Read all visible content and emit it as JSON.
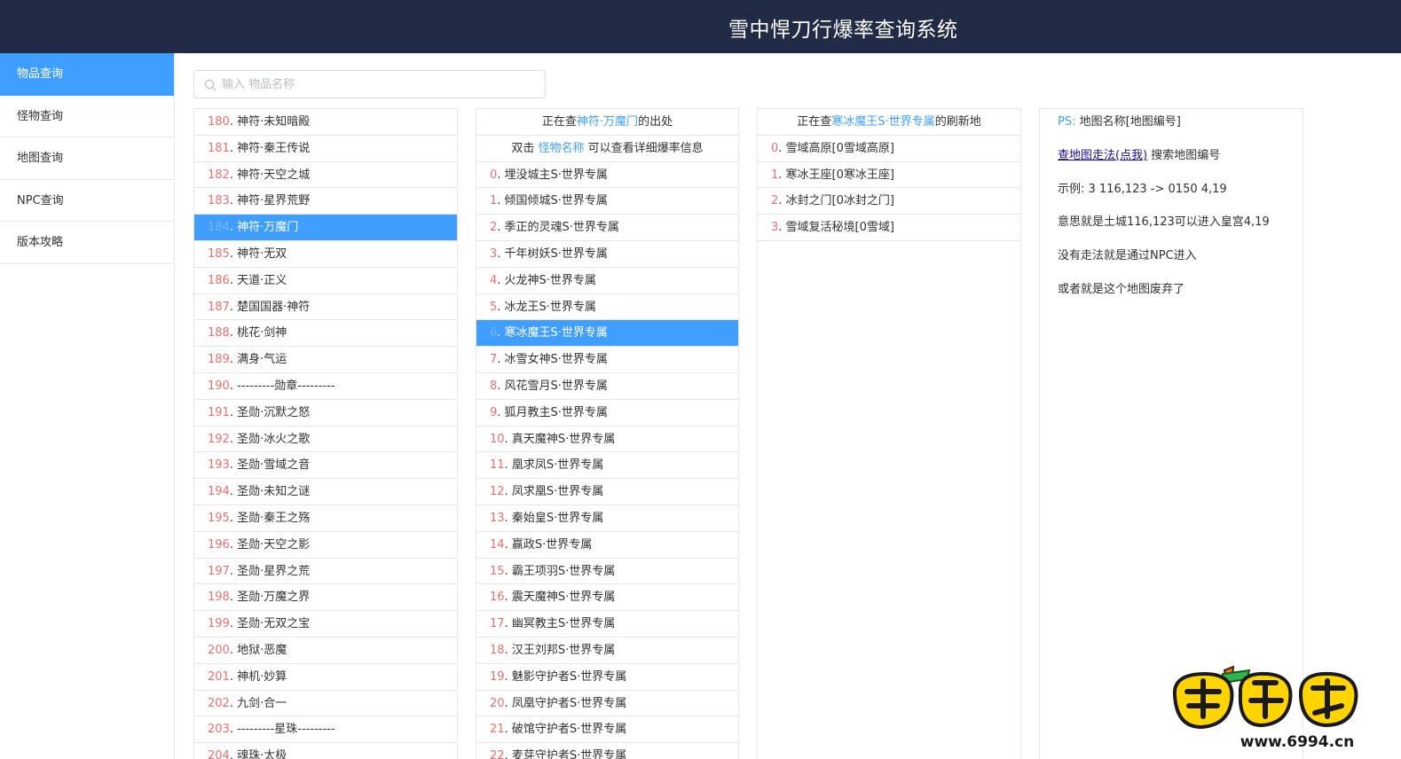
{
  "header": {
    "title": "雪中悍刀行爆率查询系统"
  },
  "sidebar": {
    "items": [
      {
        "label": "物品查询",
        "active": true
      },
      {
        "label": "怪物查询",
        "active": false
      },
      {
        "label": "地图查询",
        "active": false
      },
      {
        "label": "NPC查询",
        "active": false
      },
      {
        "label": "版本攻略",
        "active": false
      }
    ]
  },
  "search": {
    "placeholder": "输入 物品名称",
    "value": ""
  },
  "items": {
    "selected_index": 4,
    "rows": [
      {
        "idx": "180",
        "name": "神符·未知暗殿"
      },
      {
        "idx": "181",
        "name": "神符·秦王传说"
      },
      {
        "idx": "182",
        "name": "神符·天空之城"
      },
      {
        "idx": "183",
        "name": "神符·星界荒野"
      },
      {
        "idx": "184",
        "name": "神符·万魔门"
      },
      {
        "idx": "185",
        "name": "神符·无双"
      },
      {
        "idx": "186",
        "name": "天道·正义"
      },
      {
        "idx": "187",
        "name": "楚国国器·神符"
      },
      {
        "idx": "188",
        "name": "桃花·剑神"
      },
      {
        "idx": "189",
        "name": "满身·气运"
      },
      {
        "idx": "190",
        "name": "---------勋章---------"
      },
      {
        "idx": "191",
        "name": "圣勋·沉默之怒"
      },
      {
        "idx": "192",
        "name": "圣勋·冰火之歌"
      },
      {
        "idx": "193",
        "name": "圣勋·雪域之音"
      },
      {
        "idx": "194",
        "name": "圣勋·未知之谜"
      },
      {
        "idx": "195",
        "name": "圣勋·秦王之殇"
      },
      {
        "idx": "196",
        "name": "圣勋·天空之影"
      },
      {
        "idx": "197",
        "name": "圣勋·星界之荒"
      },
      {
        "idx": "198",
        "name": "圣勋·万魔之界"
      },
      {
        "idx": "199",
        "name": "圣勋·无双之宝"
      },
      {
        "idx": "200",
        "name": "地狱·恶魔"
      },
      {
        "idx": "201",
        "name": "神机·妙算"
      },
      {
        "idx": "202",
        "name": "九剑·合一"
      },
      {
        "idx": "203",
        "name": "---------星珠---------"
      },
      {
        "idx": "204",
        "name": "魂珠·太极"
      }
    ]
  },
  "monsters": {
    "header1": {
      "prefix": "正在查",
      "item": "神符·万魔门",
      "suffix": "的出处"
    },
    "header2": {
      "prefix": "双击 ",
      "link": "怪物名称",
      "suffix": " 可以查看详细爆率信息"
    },
    "selected_index": 6,
    "rows": [
      {
        "idx": "0",
        "name": "埋没城主S·世界专属"
      },
      {
        "idx": "1",
        "name": "倾国倾城S·世界专属"
      },
      {
        "idx": "2",
        "name": "季正的灵魂S·世界专属"
      },
      {
        "idx": "3",
        "name": "千年树妖S·世界专属"
      },
      {
        "idx": "4",
        "name": "火龙神S·世界专属"
      },
      {
        "idx": "5",
        "name": "冰龙王S·世界专属"
      },
      {
        "idx": "6",
        "name": "寒冰魔王S·世界专属"
      },
      {
        "idx": "7",
        "name": "冰雪女神S·世界专属"
      },
      {
        "idx": "8",
        "name": "风花雪月S·世界专属"
      },
      {
        "idx": "9",
        "name": "狐月教主S·世界专属"
      },
      {
        "idx": "10",
        "name": "真天魔神S·世界专属"
      },
      {
        "idx": "11",
        "name": "凰求凤S·世界专属"
      },
      {
        "idx": "12",
        "name": "凤求凰S·世界专属"
      },
      {
        "idx": "13",
        "name": "秦始皇S·世界专属"
      },
      {
        "idx": "14",
        "name": "赢政S·世界专属"
      },
      {
        "idx": "15",
        "name": "霸王项羽S·世界专属"
      },
      {
        "idx": "16",
        "name": "震天魔神S·世界专属"
      },
      {
        "idx": "17",
        "name": "幽冥教主S·世界专属"
      },
      {
        "idx": "18",
        "name": "汉王刘邦S·世界专属"
      },
      {
        "idx": "19",
        "name": "魅影守护者S·世界专属"
      },
      {
        "idx": "20",
        "name": "凤凰守护者S·世界专属"
      },
      {
        "idx": "21",
        "name": "破馆守护者S·世界专属"
      },
      {
        "idx": "22",
        "name": "麦芽守护者S·世界专属"
      }
    ]
  },
  "maps": {
    "header": {
      "prefix": "正在查",
      "monster": "寒冰魔王S·世界专属",
      "suffix": "的刷新地"
    },
    "rows": [
      {
        "idx": "0",
        "name": "雪域高原[0雪域高原]"
      },
      {
        "idx": "1",
        "name": "寒冰王座[0寒冰王座]"
      },
      {
        "idx": "2",
        "name": "冰封之门[0冰封之门]"
      },
      {
        "idx": "3",
        "name": "雪域复活秘境[0雪域]"
      }
    ]
  },
  "notes": {
    "ps_label": "PS:",
    "ps_text": "  地图名称[地图编号]",
    "link_label": "查地图走法(点我)",
    "link_suffix": " 搜索地图编号",
    "example": "示例:  3 116,123 -> 0150 4,19",
    "meaning": "意思就是土城116,123可以进入皇宫4,19",
    "no_route": "没有走法就是通过NPC进入",
    "abandoned": "或者就是这个地图废弃了"
  },
  "watermark": {
    "site": "www.6994.cn"
  },
  "colors": {
    "header_bg": "#222b45",
    "accent": "#409eff",
    "index_red": "#f56c6c",
    "link": "#1a0dab"
  }
}
